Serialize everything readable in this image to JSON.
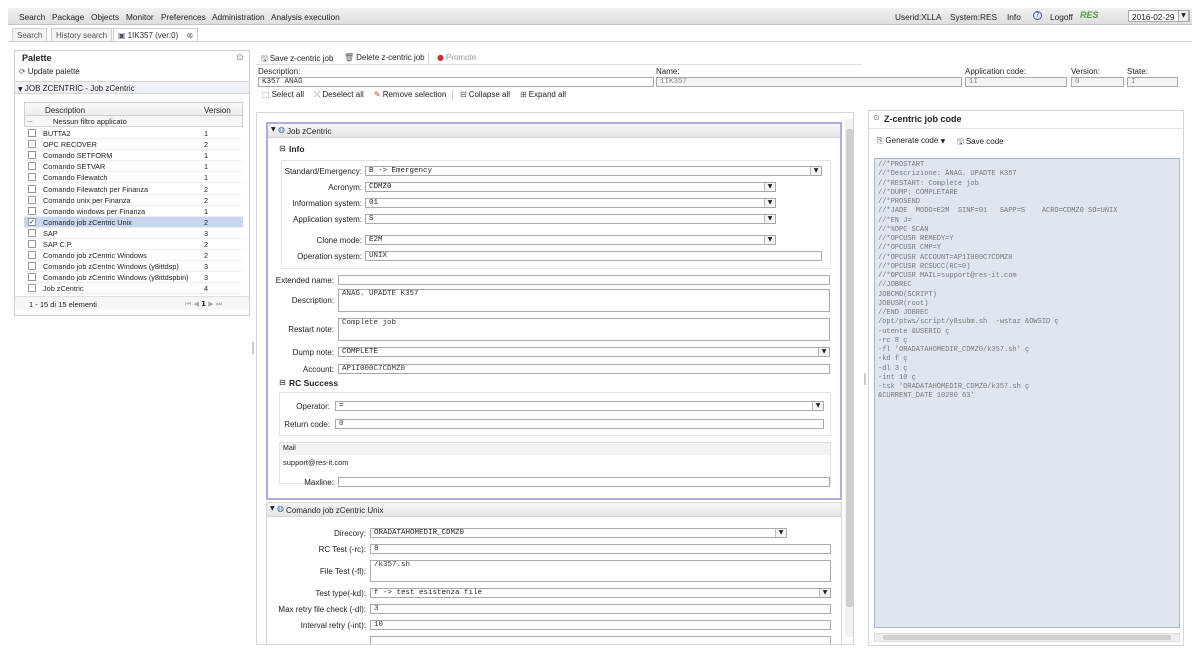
{
  "menu": {
    "search": "Search",
    "package": "Package",
    "objects": "Objects",
    "monitor": "Monitor",
    "preferences": "Preferences",
    "administration": "Administration",
    "analysis": "Analysis execution"
  },
  "userbar": {
    "userid": "Userid:XLLA",
    "system": "System:RES",
    "info": "Info",
    "logoff": "Logoff",
    "logo_text": "RES",
    "date": "2016-02-29"
  },
  "tabs": {
    "search": "Search",
    "history": "History search",
    "job": "1IK357 (ver:0)"
  },
  "palette": {
    "title": "Palette",
    "update": "Update palette",
    "group": "JOB ZCENTRIC - Job zCentric",
    "col_desc": "Description",
    "col_version": "Version",
    "filter": "Nessun filtro applicato",
    "filter_btn": "...",
    "rows": [
      {
        "desc": "BUTTA2",
        "ver": "1",
        "checked": false
      },
      {
        "desc": "OPC RECOVER",
        "ver": "2",
        "checked": false
      },
      {
        "desc": "Comando SETFORM",
        "ver": "1",
        "checked": false
      },
      {
        "desc": "Comando SETVAR",
        "ver": "1",
        "checked": false
      },
      {
        "desc": "Comando Filewatch",
        "ver": "1",
        "checked": false
      },
      {
        "desc": "Comando Filewatch per Finanza",
        "ver": "2",
        "checked": false
      },
      {
        "desc": "Comando unix per Finanza",
        "ver": "2",
        "checked": false
      },
      {
        "desc": "Comando windows per Finanza",
        "ver": "1",
        "checked": false
      },
      {
        "desc": "Comando job zCentric Unix",
        "ver": "2",
        "checked": true
      },
      {
        "desc": "SAP",
        "ver": "3",
        "checked": false
      },
      {
        "desc": "SAP C.P.",
        "ver": "2",
        "checked": false
      },
      {
        "desc": "Comando job zCentric Windows",
        "ver": "2",
        "checked": false
      },
      {
        "desc": "Comando job zCentric Windows (y8ittdsp)",
        "ver": "3",
        "checked": false
      },
      {
        "desc": "Comando job zCentric Windows (y8ittdspbin)",
        "ver": "3",
        "checked": false
      },
      {
        "desc": "Job zCentric",
        "ver": "4",
        "checked": false
      }
    ],
    "pager": "1 - 15 di 15 elementi",
    "page": "1"
  },
  "toolbar": {
    "save": "Save z-centric job",
    "delete": "Delete z-centric job",
    "promote": "Promote"
  },
  "header": {
    "desc_label": "Description:",
    "desc_value": "K357 ANAG",
    "name_label": "Name:",
    "name_value": "1IK357",
    "appcode_label": "Application code:",
    "appcode_value": "1I",
    "version_label": "Version:",
    "version_value": "0",
    "state_label": "State:",
    "state_value": "I"
  },
  "toolbar2": {
    "select_all": "Select all",
    "deselect_all": "Deselect all",
    "remove": "Remove selection",
    "collapse": "Collapse all",
    "expand": "Expand all"
  },
  "jobpanel": {
    "title": "Job zCentric",
    "info_title": "Info",
    "standard_label": "Standard/Emergency:",
    "standard_value": "B -> Emergency",
    "acronym_label": "Acronym:",
    "acronym_value": "CDMZ0",
    "infosys_label": "Information system:",
    "infosys_value": "01",
    "appsys_label": "Application system:",
    "appsys_value": "S",
    "clone_label": "Clone mode:",
    "clone_value": "E2M",
    "opsys_label": "Operation system:",
    "opsys_value": "UNIX",
    "extname_label": "Extended name:",
    "extname_value": "",
    "description_label": "Description:",
    "description_value": "ANAG. UPADTE K357",
    "restart_label": "Restart note:",
    "restart_value": "Complete job",
    "dump_label": "Dump note:",
    "dump_value": "COMPLETE",
    "account_label": "Account:",
    "account_value": "AP1I000C7CDMZ0",
    "rc_title": "RC Success",
    "operator_label": "Operator:",
    "operator_value": "=",
    "retcode_label": "Return code:",
    "retcode_value": "0",
    "mail_label": "Mail",
    "mail_value": "support@res-it.com",
    "maxline_label": "Maxline:",
    "maxline_value": ""
  },
  "cmdpanel": {
    "title": "Comando job zCentric Unix",
    "dir_label": "Direcory:",
    "dir_value": "ORADATAHOMEDIR_CDMZ0",
    "rc_label": "RC Test (-rc):",
    "rc_value": "8",
    "file_label": "File Test (-fl):",
    "file_value": "/k357.sh",
    "type_label": "Test type(-kd):",
    "type_value": "f -> test esistenza file",
    "maxretry_label": "Max retry file check (-dl):",
    "maxretry_value": "3",
    "interval_label": "Interval retry (-int):",
    "interval_value": "10"
  },
  "codepanel": {
    "title": "Z-centric job code",
    "generate": "Generate code",
    "save": "Save code",
    "lines": [
      "//*PROSTART",
      "//*Descrizione: ANAG. UPADTE K357",
      "//*RESTART: Complete job",
      "//*DUMP: COMPLETARE",
      "//*PROSEND",
      "//*JADE  MODO=E2M  SINF=01   SAPP=S    ACRO=CDMZ0 SO=UNIX",
      "//*EN J=",
      "//*%OPC SCAN",
      "//*OPCUSR REMEDY=Y",
      "//*OPCUSR CMP=Y",
      "//*OPCUSR ACCOUNT=AP1I000C7CDMZ0",
      "//*OPCUSR RCSUCC(RC=0)",
      "//*OPCUSR MAIL=support@res-it.com",
      "//JOBREC",
      "JOBCMD(SCRIPT)",
      "JOBUSR(root)",
      "//END JOBREC",
      "/opt/ptws/script/y8subm.sh  -wstaz &OWSID ç",
      "-utente &USERID ç",
      "-rc 8 ç",
      "-fl 'ORADATAHOMEDIR_CDMZ0/k357.sh' ç",
      "-kd f ç",
      "-dl 3 ç",
      "-int 10 ç",
      "-tsk 'ORADATAHOMEDIR_CDMZ0/k357.sh ç",
      "&CURRENT_DATE 10200 63'"
    ]
  },
  "colors": {
    "accent": "#b8cbe8",
    "panel_border": "#b7a9d9",
    "selected_row": "#c6d7ef"
  }
}
